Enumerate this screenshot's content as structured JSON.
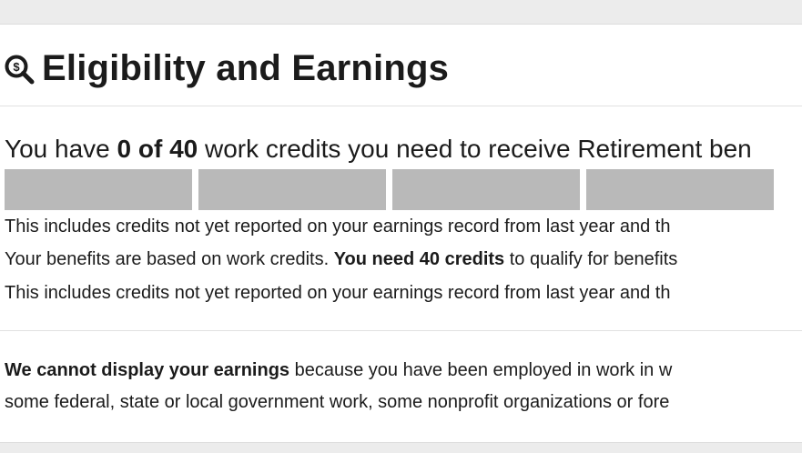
{
  "section": {
    "title": "Eligibility and Earnings",
    "icon": "magnifier-dollar-icon"
  },
  "credits": {
    "prefix": "You have ",
    "count": "0 of 40",
    "suffix": " work credits you need to receive Retirement ben",
    "progress_filled": 0,
    "progress_total": 4
  },
  "notes": {
    "line1": "This includes credits not yet reported on your earnings record from last year and th",
    "line2_prefix": "Your benefits are based on work credits. ",
    "line2_bold": "You need 40 credits",
    "line2_suffix": " to qualify for benefits",
    "line3": "This includes credits not yet reported on your earnings record from last year and th"
  },
  "earnings": {
    "bold": "We cannot display your earnings",
    "line1_rest": " because you have been employed in work in w",
    "line2": "some federal, state or local government work, some nonprofit organizations or fore"
  },
  "colors": {
    "bar_empty": "#b9b9b9",
    "background": "#ececec",
    "card": "#ffffff"
  }
}
